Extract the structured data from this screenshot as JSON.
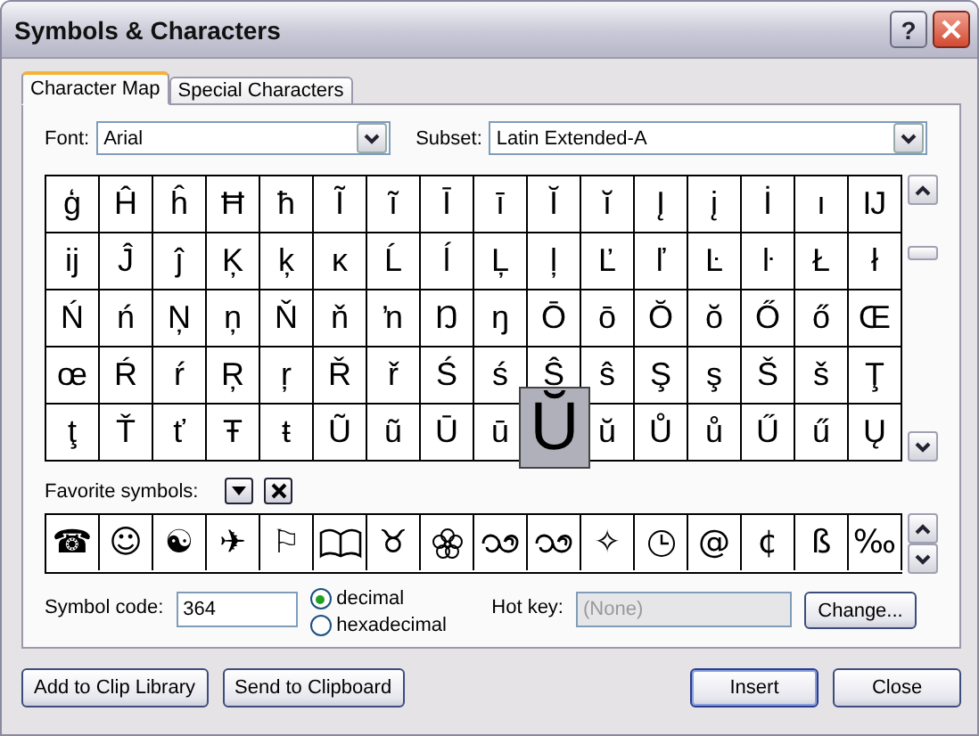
{
  "window": {
    "title": "Symbols & Characters",
    "help_button": "?"
  },
  "tabs": [
    {
      "label": "Character Map",
      "selected": true
    },
    {
      "label": "Special Characters",
      "selected": false
    }
  ],
  "font": {
    "label": "Font:",
    "value": "Arial"
  },
  "subset": {
    "label": "Subset:",
    "value": "Latin Extended-A"
  },
  "grid": [
    [
      {
        "char": "ģ",
        "selected": false
      },
      {
        "char": "Ĥ",
        "selected": false
      },
      {
        "char": "ĥ",
        "selected": false
      },
      {
        "char": "Ħ",
        "selected": false
      },
      {
        "char": "ħ",
        "selected": false
      },
      {
        "char": "Ĩ",
        "selected": false
      },
      {
        "char": "ĩ",
        "selected": false
      },
      {
        "char": "Ī",
        "selected": false
      },
      {
        "char": "ī",
        "selected": false
      },
      {
        "char": "Ĭ",
        "selected": false
      },
      {
        "char": "ĭ",
        "selected": false
      },
      {
        "char": "Į",
        "selected": false
      },
      {
        "char": "į",
        "selected": false
      },
      {
        "char": "İ",
        "selected": false
      },
      {
        "char": "ı",
        "selected": false
      },
      {
        "char": "Ĳ",
        "selected": false
      }
    ],
    [
      {
        "char": "ĳ",
        "selected": false
      },
      {
        "char": "Ĵ",
        "selected": false
      },
      {
        "char": "ĵ",
        "selected": false
      },
      {
        "char": "Ķ",
        "selected": false
      },
      {
        "char": "ķ",
        "selected": false
      },
      {
        "char": "ĸ",
        "selected": false
      },
      {
        "char": "Ĺ",
        "selected": false
      },
      {
        "char": "ĺ",
        "selected": false
      },
      {
        "char": "Ļ",
        "selected": false
      },
      {
        "char": "ļ",
        "selected": false
      },
      {
        "char": "Ľ",
        "selected": false
      },
      {
        "char": "ľ",
        "selected": false
      },
      {
        "char": "Ŀ",
        "selected": false
      },
      {
        "char": "ŀ",
        "selected": false
      },
      {
        "char": "Ł",
        "selected": false
      },
      {
        "char": "ł",
        "selected": false
      }
    ],
    [
      {
        "char": "Ń",
        "selected": false
      },
      {
        "char": "ń",
        "selected": false
      },
      {
        "char": "Ņ",
        "selected": false
      },
      {
        "char": "ņ",
        "selected": false
      },
      {
        "char": "Ň",
        "selected": false
      },
      {
        "char": "ň",
        "selected": false
      },
      {
        "char": "ŉ",
        "selected": false
      },
      {
        "char": "Ŋ",
        "selected": false
      },
      {
        "char": "ŋ",
        "selected": false
      },
      {
        "char": "Ō",
        "selected": false
      },
      {
        "char": "ō",
        "selected": false
      },
      {
        "char": "Ŏ",
        "selected": false
      },
      {
        "char": "ŏ",
        "selected": false
      },
      {
        "char": "Ő",
        "selected": false
      },
      {
        "char": "ő",
        "selected": false
      },
      {
        "char": "Œ",
        "selected": false
      }
    ],
    [
      {
        "char": "œ",
        "selected": false
      },
      {
        "char": "Ŕ",
        "selected": false
      },
      {
        "char": "ŕ",
        "selected": false
      },
      {
        "char": "Ŗ",
        "selected": false
      },
      {
        "char": "ŗ",
        "selected": false
      },
      {
        "char": "Ř",
        "selected": false
      },
      {
        "char": "ř",
        "selected": false
      },
      {
        "char": "Ś",
        "selected": false
      },
      {
        "char": "ś",
        "selected": false
      },
      {
        "char": "Ŝ",
        "selected": false
      },
      {
        "char": "ŝ",
        "selected": false
      },
      {
        "char": "Ş",
        "selected": false
      },
      {
        "char": "ş",
        "selected": false
      },
      {
        "char": "Š",
        "selected": false
      },
      {
        "char": "š",
        "selected": false
      },
      {
        "char": "Ţ",
        "selected": false
      }
    ],
    [
      {
        "char": "ţ",
        "selected": false
      },
      {
        "char": "Ť",
        "selected": false
      },
      {
        "char": "ť",
        "selected": false
      },
      {
        "char": "Ŧ",
        "selected": false
      },
      {
        "char": "ŧ",
        "selected": false
      },
      {
        "char": "Ũ",
        "selected": false
      },
      {
        "char": "ũ",
        "selected": false
      },
      {
        "char": "Ū",
        "selected": false
      },
      {
        "char": "ū",
        "selected": false
      },
      {
        "char": "Ŭ",
        "selected": true
      },
      {
        "char": "ŭ",
        "selected": false
      },
      {
        "char": "Ů",
        "selected": false
      },
      {
        "char": "ů",
        "selected": false
      },
      {
        "char": "Ű",
        "selected": false
      },
      {
        "char": "ű",
        "selected": false
      },
      {
        "char": "Ų",
        "selected": false
      }
    ]
  ],
  "favorites": {
    "label": "Favorite symbols:",
    "items": [
      {
        "kind": "char",
        "char": "☎"
      },
      {
        "kind": "char",
        "char": "☺"
      },
      {
        "kind": "char",
        "char": "☯"
      },
      {
        "kind": "char",
        "char": "✈"
      },
      {
        "kind": "char",
        "char": "⚐"
      },
      {
        "kind": "book"
      },
      {
        "kind": "char",
        "char": "♉"
      },
      {
        "kind": "rosette"
      },
      {
        "kind": "ornament"
      },
      {
        "kind": "ornament"
      },
      {
        "kind": "char",
        "char": "✧"
      },
      {
        "kind": "clock"
      },
      {
        "kind": "char",
        "char": "@"
      },
      {
        "kind": "char",
        "char": "¢"
      },
      {
        "kind": "char",
        "char": "ß"
      },
      {
        "kind": "char",
        "char": "‰"
      }
    ]
  },
  "symbol_code": {
    "label": "Symbol code:",
    "value": "364"
  },
  "code_base": [
    {
      "label": "decimal",
      "selected": true
    },
    {
      "label": "hexadecimal",
      "selected": false
    }
  ],
  "hot_key": {
    "label": "Hot key:",
    "placeholder": "(None)",
    "disabled": true,
    "button": "Change..."
  },
  "buttons": {
    "left": [
      "Add to Clip Library",
      "Send to Clipboard"
    ],
    "right": [
      {
        "label": "Insert",
        "default": true
      },
      {
        "label": "Close",
        "default": false
      }
    ]
  }
}
